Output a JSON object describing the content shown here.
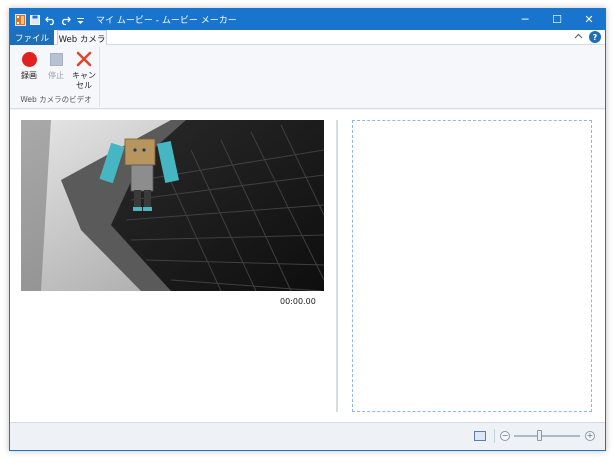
{
  "window": {
    "title": "マイ ムービー - ムービー メーカー",
    "controls": {
      "minimize": "─",
      "maximize": "☐",
      "close": "✕"
    }
  },
  "quick_access": [
    {
      "icon": "film-icon"
    },
    {
      "icon": "save-icon"
    },
    {
      "icon": "undo-icon"
    },
    {
      "icon": "redo-icon"
    },
    {
      "icon": "customize-icon"
    }
  ],
  "tabs": {
    "file": "ファイル",
    "webcam": "Web カメラ"
  },
  "ribbon": {
    "group_label": "Web カメラのビデオ",
    "record": "録画",
    "stop": "停止",
    "cancel": "キャンセル"
  },
  "preview": {
    "timecode": "00:00.00"
  },
  "colors": {
    "titlebar": "#1874cd",
    "file_tab": "#1e6fb9",
    "record": "#e32020",
    "cancel": "#e0462b"
  }
}
